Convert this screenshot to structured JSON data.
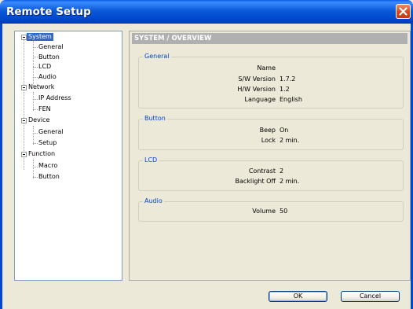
{
  "window": {
    "title": "Remote Setup"
  },
  "tree": {
    "items": [
      {
        "label": "System",
        "level": 0,
        "selected": true
      },
      {
        "label": "General",
        "level": 1
      },
      {
        "label": "Button",
        "level": 1
      },
      {
        "label": "LCD",
        "level": 1
      },
      {
        "label": "Audio",
        "level": 1
      },
      {
        "label": "Network",
        "level": 0
      },
      {
        "label": "IP Address",
        "level": 1
      },
      {
        "label": "FEN",
        "level": 1
      },
      {
        "label": "Device",
        "level": 0
      },
      {
        "label": "General",
        "level": 1
      },
      {
        "label": "Setup",
        "level": 1
      },
      {
        "label": "Function",
        "level": 0
      },
      {
        "label": "Macro",
        "level": 1
      },
      {
        "label": "Button",
        "level": 1
      }
    ]
  },
  "content": {
    "header": "SYSTEM / OVERVIEW",
    "groups": {
      "general": {
        "title": "General",
        "name_label": "Name",
        "name_value": "",
        "sw_label": "S/W Version",
        "sw_value": "1.7.2",
        "hw_label": "H/W Version",
        "hw_value": "1.2",
        "lang_label": "Language",
        "lang_value": "English"
      },
      "button": {
        "title": "Button",
        "beep_label": "Beep",
        "beep_value": "On",
        "lock_label": "Lock",
        "lock_value": "2 min."
      },
      "lcd": {
        "title": "LCD",
        "contrast_label": "Contrast",
        "contrast_value": "2",
        "backlight_label": "Backlight Off",
        "backlight_value": "2 min."
      },
      "audio": {
        "title": "Audio",
        "volume_label": "Volume",
        "volume_value": "50"
      }
    }
  },
  "buttons": {
    "ok": "OK",
    "cancel": "Cancel"
  }
}
